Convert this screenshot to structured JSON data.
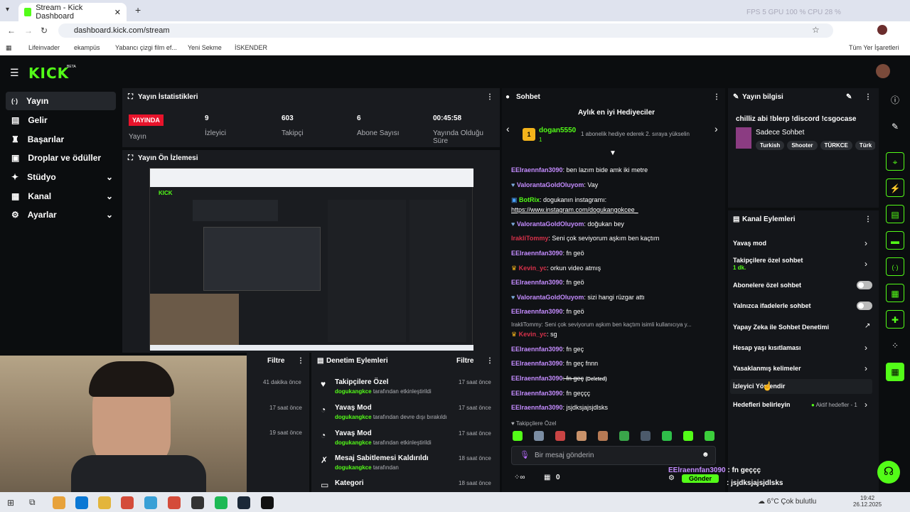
{
  "browser": {
    "tab_title": "Stream - Kick Dashboard",
    "url": "dashboard.kick.com/stream",
    "bookmarks": [
      "Lifeinvader",
      "ekampüs",
      "Yabancı çizgi film ef...",
      "Yeni Sekme",
      "İSKENDER"
    ],
    "all_bookmarks": "Tüm Yer İşaretleri",
    "perf": "FPS  5     GPU 100 %     CPU 28 %"
  },
  "app": {
    "logo": "KICK",
    "beta": "BETA"
  },
  "sidebar": {
    "items": [
      {
        "label": "Yayın"
      },
      {
        "label": "Gelir"
      },
      {
        "label": "Başarılar"
      },
      {
        "label": "Droplar ve ödüller"
      },
      {
        "label": "Stüdyo"
      },
      {
        "label": "Kanal"
      },
      {
        "label": "Ayarlar"
      }
    ]
  },
  "stats": {
    "title": "Yayın İstatistikleri",
    "live": "YAYINDA",
    "live_label": "Yayın",
    "items": [
      {
        "value": "9",
        "label": "İzleyici"
      },
      {
        "value": "603",
        "label": "Takipçi"
      },
      {
        "value": "6",
        "label": "Abone Sayısı"
      },
      {
        "value": "00:45:58",
        "label": "Yayında Olduğu Süre"
      }
    ]
  },
  "preview": {
    "title": "Yayın Ön İzlemesi"
  },
  "filter1": {
    "label": "Filtre",
    "times": [
      "41 dakika önce",
      "17 saat önce",
      "19 saat önce"
    ]
  },
  "moderation": {
    "title": "Denetim Eylemleri",
    "filter": "Filtre",
    "items": [
      {
        "title": "Takipçilere Özel",
        "user": "dogukangkce",
        "desc": "tarafından etkinleştirildi",
        "time": "17 saat önce"
      },
      {
        "title": "Yavaş Mod",
        "user": "dogukangkce",
        "desc": "tarafından devre dışı bırakıldı",
        "time": "17 saat önce"
      },
      {
        "title": "Yavaş Mod",
        "user": "dogukangkce",
        "desc": "tarafından etkinleştirildi",
        "time": "17 saat önce"
      },
      {
        "title": "Mesaj Sabitlemesi Kaldırıldı",
        "user": "dogukangkce",
        "desc": "tarafından",
        "time": "18 saat önce"
      },
      {
        "title": "Kategori",
        "user": "",
        "desc": "",
        "time": "18 saat önce"
      }
    ]
  },
  "chat": {
    "title": "Sohbet",
    "gifters_title": "Aylık en iyi Hediyeciler",
    "top_gifter": "dogan5550",
    "top_gifter_count": "1",
    "gifter_note": "1 abonelik hediye ederek 2. sıraya yükselin",
    "messages": [
      {
        "user": "EElraennfan3090",
        "text": ": ben lazım bide amk iki metre"
      },
      {
        "user": "ValorantaGoldOluyom",
        "text": ": Vay"
      },
      {
        "user": "BotRix",
        "text": ": dogukanın instagramı:"
      },
      {
        "user": "",
        "text": "https://www.instagram.com/dogukangokcee_"
      },
      {
        "user": "ValorantaGoldOluyom",
        "text": ": doğukan bey"
      },
      {
        "user": "IrakliTommy",
        "text": ": Seni çok seviyorum aşkım ben kaçtım"
      },
      {
        "user": "EElraennfan3090",
        "text": ": fn geö"
      },
      {
        "user": "Kevin_yc",
        "text": ": orkun video atmış"
      },
      {
        "user": "EElraennfan3090",
        "text": ": fn geö"
      },
      {
        "user": "ValorantaGoldOluyom",
        "text": ": sizi hangi rüzgar attı"
      },
      {
        "user": "EElraennfan3090",
        "text": ": fn geö"
      },
      {
        "user": "",
        "text": "IrakliTommy: Seni çok seviyorum aşkım ben kaçtım isimli kullanıcıya y..."
      },
      {
        "user": "Kevin_yc",
        "text": ": sg"
      },
      {
        "user": "EElraennfan3090",
        "text": ": fn geç"
      },
      {
        "user": "EElraennfan3090",
        "text": ": fn geç fnnn"
      },
      {
        "user": "EElraennfan3090",
        "text": ": fn geç"
      },
      {
        "user": "EElraennfan3090",
        "text": ": fn geççç"
      },
      {
        "user": "EElraennfan3090",
        "text": ": jsjdksjajsjdlsks"
      }
    ],
    "deleted": "(Deleted)",
    "followers_only": "Takipçilere Özel",
    "placeholder": "Bir mesaj gönderin",
    "send": "Gönder",
    "points": "0"
  },
  "stream_info": {
    "title": "Yayın bilgisi",
    "stream_title": "chilliz abi !blerp !discord !csgocase",
    "category": "Sadece Sohbet",
    "tags": [
      "Turkish",
      "Shooter",
      "TÜRKCE",
      "Türk"
    ]
  },
  "channel_actions": {
    "title": "Kanal Eylemleri",
    "items": [
      {
        "label": "Yavaş mod",
        "sub": ""
      },
      {
        "label": "Takipçilere özel sohbet",
        "sub": "1 dk."
      },
      {
        "label": "Abonelere özel sohbet",
        "sub": ""
      },
      {
        "label": "Yalnızca ifadelerle sohbet",
        "sub": ""
      },
      {
        "label": "Yapay Zeka ile Sohbet Denetimi",
        "sub": ""
      },
      {
        "label": "Hesap yaşı kısıtlaması",
        "sub": ""
      },
      {
        "label": "Yasaklanmış kelimeler",
        "sub": ""
      },
      {
        "label": "İzleyici Yönlendir",
        "sub": ""
      },
      {
        "label": "Hedefleri belirleyin",
        "sub": ""
      }
    ],
    "goals_status": "Aktif hedefler - 1"
  },
  "overlay": {
    "line1_user": "EElraennfan3090",
    "line1_text": " : fn geççç",
    "line2_text": " : jsjdksjajsjdlsks"
  },
  "taskbar": {
    "weather": "6°C  Çok bulutlu",
    "time": "19:42",
    "date": "26.12.2025"
  }
}
